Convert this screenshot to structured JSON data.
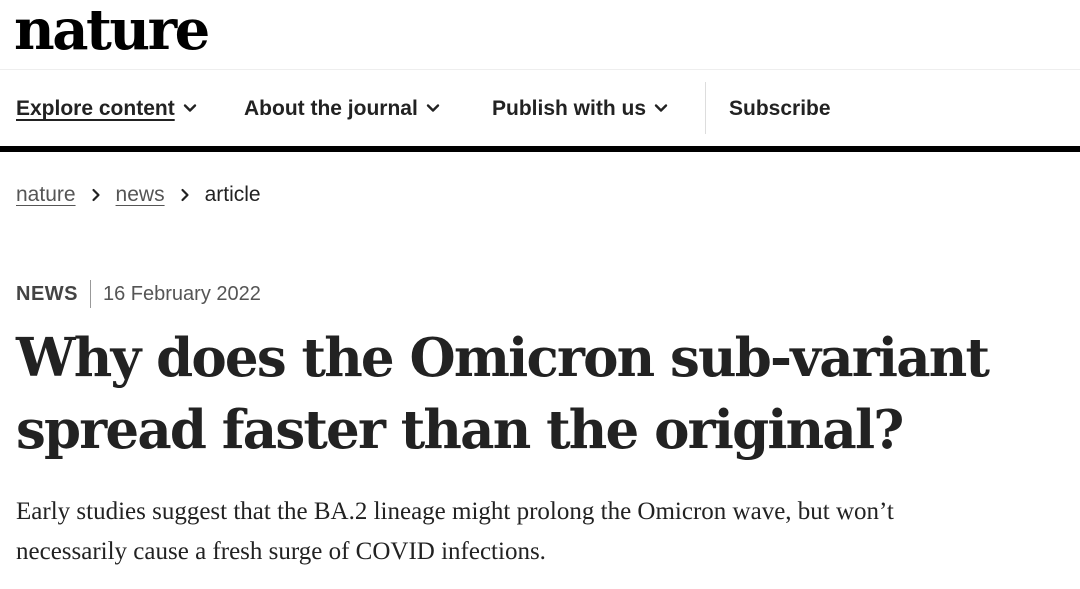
{
  "site": {
    "logo_text": "nature"
  },
  "nav": {
    "items": [
      {
        "label": "Explore content",
        "has_dropdown": true,
        "active": true
      },
      {
        "label": "About the journal",
        "has_dropdown": true,
        "active": false
      },
      {
        "label": "Publish with us",
        "has_dropdown": true,
        "active": false
      },
      {
        "label": "Subscribe",
        "has_dropdown": false,
        "active": false
      }
    ],
    "dropdown_icon": "chevron-down-icon"
  },
  "breadcrumb": {
    "items": [
      {
        "label": "nature",
        "link": true
      },
      {
        "label": "news",
        "link": true
      },
      {
        "label": "article",
        "link": false
      }
    ],
    "separator_icon": "chevron-right-icon"
  },
  "article": {
    "type": "NEWS",
    "date": "16 February 2022",
    "title_line1": "Why does the Omicron sub-variant",
    "title_line2": "spread faster than the original?",
    "standfirst_line1": "Early studies suggest that the BA.2 lineage might prolong the Omicron wave, but won’t",
    "standfirst_line2": "necessarily cause a fresh surge of COVID infections."
  },
  "colors": {
    "text": "#222222",
    "rule": "#000000",
    "muted": "#555555"
  }
}
